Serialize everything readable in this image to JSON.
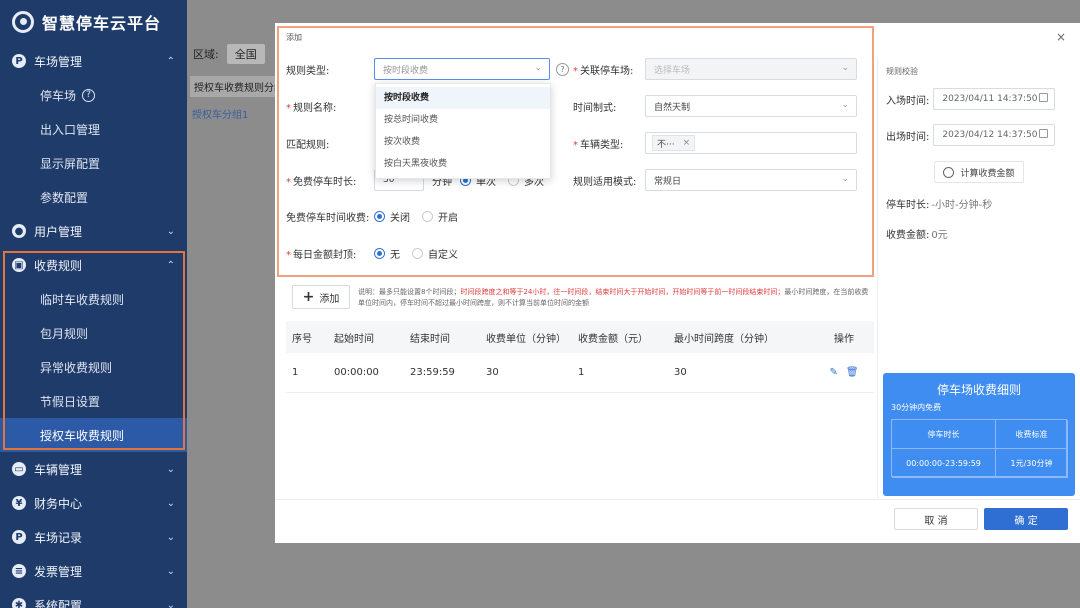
{
  "brand": {
    "title": "智慧停车云平台"
  },
  "sidebar": {
    "groups": [
      {
        "label": "车场管理",
        "icon": "P",
        "chevron": "⌃"
      },
      {
        "label": "用户管理",
        "icon": "person",
        "chevron": "⌄"
      },
      {
        "label": "收费规则",
        "icon": "wallet",
        "chevron": "⌃"
      },
      {
        "label": "车辆管理",
        "icon": "car",
        "chevron": "⌄"
      },
      {
        "label": "财务中心",
        "icon": "finance",
        "chevron": "⌄"
      },
      {
        "label": "车场记录",
        "icon": "record",
        "chevron": "⌄"
      },
      {
        "label": "发票管理",
        "icon": "invoice",
        "chevron": "⌄"
      },
      {
        "label": "系统配置",
        "icon": "gear",
        "chevron": "⌄"
      }
    ],
    "lot_items": [
      "停车场",
      "出入口管理",
      "显示屏配置",
      "参数配置"
    ],
    "fee_items": [
      "临时车收费规则",
      "包月规则",
      "异常收费规则",
      "节假日设置",
      "授权车收费规则"
    ]
  },
  "background": {
    "area_label": "区域:",
    "area_value": "全国",
    "tab_label": "授权车收费规则分组",
    "link": "授权车分组1"
  },
  "modal": {
    "title": "添加",
    "close": "×",
    "form": {
      "rule_type_label": "规则类型:",
      "rule_type_placeholder": "按时段收费",
      "related_lot_label": "关联停车场:",
      "related_lot_placeholder": "选择车场",
      "rule_name_label": "规则名称:",
      "time_system_label": "时间制式:",
      "time_system_value": "自然天制",
      "match_rule_label": "匹配规则:",
      "vehicle_type_label": "车辆类型:",
      "vehicle_type_tag": "不···",
      "free_duration_label": "免费停车时长:",
      "free_duration_value": "30",
      "free_duration_unit": "分钟",
      "free_single": "单次",
      "free_multi": "多次",
      "apply_mode_label": "规则适用模式:",
      "apply_mode_value": "常规日",
      "free_time_fee_label": "免费停车时间收费:",
      "free_time_fee_off": "关闭",
      "free_time_fee_on": "开启",
      "daily_cap_label": "每日金额封顶:",
      "daily_cap_none": "无",
      "daily_cap_custom": "自定义",
      "dropdown_options": [
        "按时段收费",
        "按总时间收费",
        "按次收费",
        "按白天黑夜收费"
      ]
    },
    "add_button": "添加",
    "note": {
      "prefix": "说明：最多只能设置8个时间段；",
      "red": "时间段跨度之和等于24小时，往一时间段，结束时间大于开始时间，开始时间等于前一时间段结束时间；",
      "rest": "最小时间跨度，在当前收费单位时间内，停车时间不超过最小时间跨度，则不计算当前单位时间的金额"
    },
    "table": {
      "headers": [
        "序号",
        "起始时间",
        "结束时间",
        "收费单位（分钟）",
        "收费金额（元）",
        "最小时间跨度（分钟）",
        "操作"
      ],
      "rows": [
        [
          "1",
          "00:00:00",
          "23:59:59",
          "30",
          "1",
          "30"
        ]
      ]
    },
    "right_panel": {
      "title": "规则校验",
      "entry_label": "入场时间:",
      "entry_value": "2023/04/11 14:37:50",
      "exit_label": "出场时间:",
      "exit_value": "2023/04/12 14:37:50",
      "calc_button": "计算收费金额",
      "duration_label": "停车时长:",
      "duration_value": "-小时-分钟-秒",
      "amount_label": "收费金额:",
      "amount_value": "0元"
    },
    "fee_card": {
      "title": "停车场收费细则",
      "subtitle": "30分钟内免费",
      "col1": "停车时长",
      "col2": "收费标准",
      "val1": "00:00:00-23:59:59",
      "val2": "1元/30分钟"
    },
    "cancel": "取 消",
    "confirm": "确 定"
  },
  "colors": {
    "sidebar": "#1f3b6a",
    "accent": "#2f6fd3",
    "highlight": "#e3743b",
    "card": "#3f8df0"
  }
}
